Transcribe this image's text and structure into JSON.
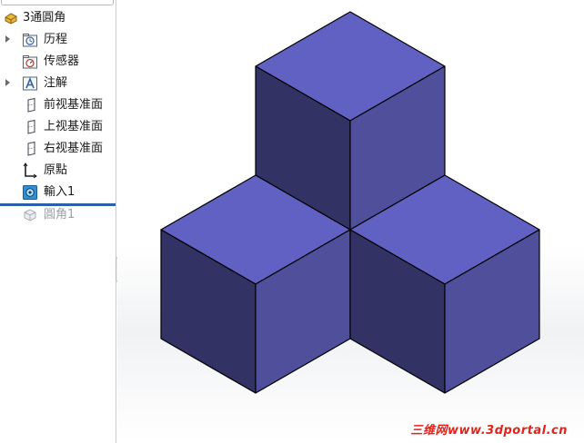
{
  "tree": {
    "root": {
      "label": "3通圓角",
      "icon": "part-icon"
    },
    "items": [
      {
        "label": "历程",
        "icon": "history-folder-icon",
        "expandable": true,
        "dim": false
      },
      {
        "label": "传感器",
        "icon": "sensor-folder-icon",
        "expandable": false,
        "dim": false
      },
      {
        "label": "注解",
        "icon": "annotation-folder-icon",
        "expandable": true,
        "dim": false
      },
      {
        "label": "前视基准面",
        "icon": "plane-icon",
        "expandable": false,
        "dim": false
      },
      {
        "label": "上视基准面",
        "icon": "plane-icon",
        "expandable": false,
        "dim": false
      },
      {
        "label": "右视基准面",
        "icon": "plane-icon",
        "expandable": false,
        "dim": false
      },
      {
        "label": "原點",
        "icon": "origin-icon",
        "expandable": false,
        "dim": false
      },
      {
        "label": "輸入1",
        "icon": "imported-body-icon",
        "expandable": false,
        "dim": false
      },
      {
        "label": "圓角1",
        "icon": "fillet-icon",
        "expandable": false,
        "dim": true
      }
    ]
  },
  "viewport": {
    "model": "three-cube-corner",
    "colors": {
      "top_face": "#6061c2",
      "right_face": "#4f4f9c",
      "left_face": "#333265",
      "edge": "#000000"
    }
  },
  "watermark": "三维网www.3dportal.cn"
}
